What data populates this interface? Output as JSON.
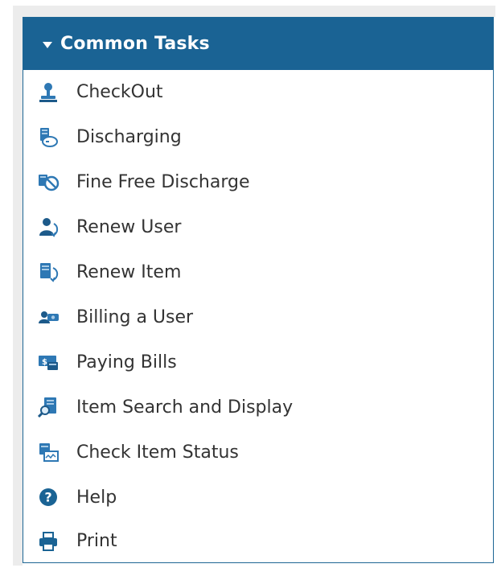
{
  "panel": {
    "title": "Common Tasks",
    "header_color": "#1a6394",
    "tasks": [
      {
        "label": "CheckOut",
        "icon": "checkout-stamp-icon"
      },
      {
        "label": "Discharging",
        "icon": "discharge-books-icon"
      },
      {
        "label": "Fine Free Discharge",
        "icon": "fine-free-discharge-icon"
      },
      {
        "label": "Renew User",
        "icon": "renew-user-icon"
      },
      {
        "label": "Renew Item",
        "icon": "renew-item-icon"
      },
      {
        "label": "Billing a User",
        "icon": "billing-user-icon"
      },
      {
        "label": "Paying Bills",
        "icon": "paying-bills-icon"
      },
      {
        "label": "Item Search and Display",
        "icon": "item-search-icon"
      },
      {
        "label": "Check Item Status",
        "icon": "item-status-icon"
      },
      {
        "label": "Help",
        "icon": "help-icon"
      },
      {
        "label": "Print",
        "icon": "print-icon"
      }
    ]
  }
}
